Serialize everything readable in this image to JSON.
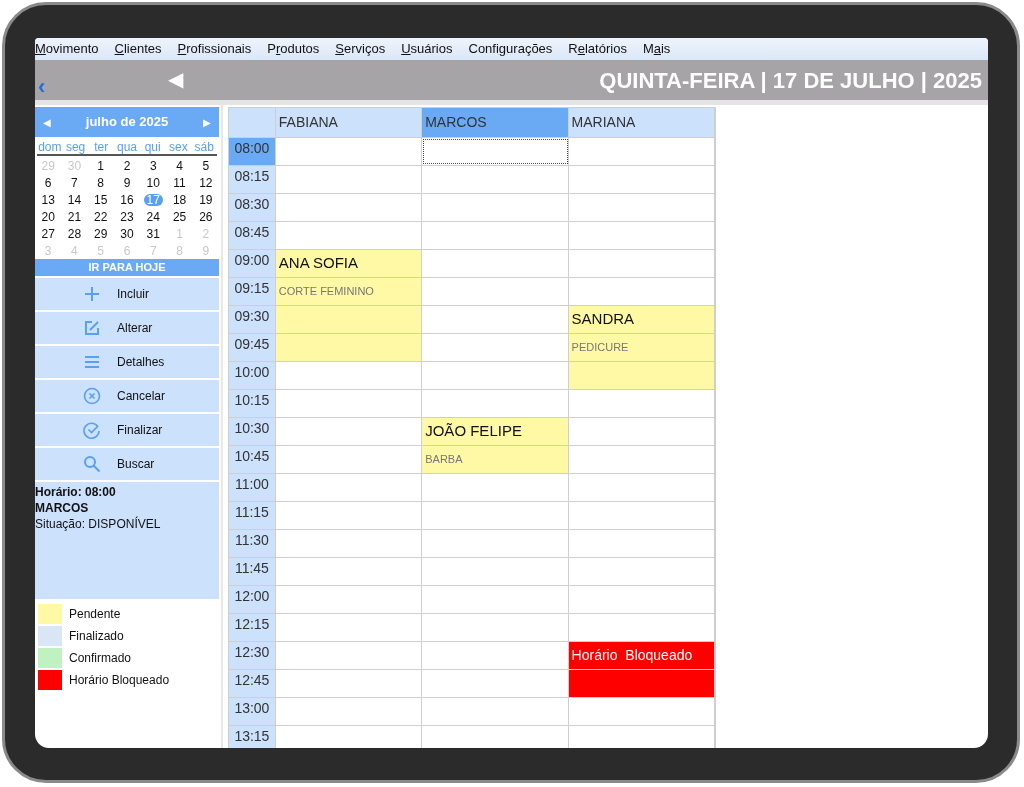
{
  "menu": [
    {
      "key": "M",
      "after": "ovimento"
    },
    {
      "key": "C",
      "after": "lientes"
    },
    {
      "key": "P",
      "after": "rofissionais"
    },
    {
      "before": "P",
      "key": "r",
      "after": "odutos"
    },
    {
      "key": "S",
      "after": "erviços"
    },
    {
      "key": "U",
      "after": "suários"
    },
    {
      "before": "Confi",
      "key": "g",
      "after": "urações"
    },
    {
      "before": "R",
      "key": "e",
      "after": "latórios"
    },
    {
      "before": "M",
      "key": "a",
      "after": "is"
    }
  ],
  "header": {
    "back": "‹",
    "previous": "◀",
    "title": "QUINTA-FEIRA | 17 DE JULHO | 2025"
  },
  "calendar": {
    "previous": "◀",
    "month": "julho de 2025",
    "next": "▶",
    "weekdays": [
      "dom",
      "seg",
      "ter",
      "qua",
      "qui",
      "sex",
      "sáb"
    ],
    "days": [
      {
        "label": "29",
        "muted": true,
        "selected": false
      },
      {
        "label": "30",
        "muted": true,
        "selected": false
      },
      {
        "label": "1",
        "muted": false,
        "selected": false
      },
      {
        "label": "2",
        "muted": false,
        "selected": false
      },
      {
        "label": "3",
        "muted": false,
        "selected": false
      },
      {
        "label": "4",
        "muted": false,
        "selected": false
      },
      {
        "label": "5",
        "muted": false,
        "selected": false
      },
      {
        "label": "6",
        "muted": false,
        "selected": false
      },
      {
        "label": "7",
        "muted": false,
        "selected": false
      },
      {
        "label": "8",
        "muted": false,
        "selected": false
      },
      {
        "label": "9",
        "muted": false,
        "selected": false
      },
      {
        "label": "10",
        "muted": false,
        "selected": false
      },
      {
        "label": "11",
        "muted": false,
        "selected": false
      },
      {
        "label": "12",
        "muted": false,
        "selected": false
      },
      {
        "label": "13",
        "muted": false,
        "selected": false
      },
      {
        "label": "14",
        "muted": false,
        "selected": false
      },
      {
        "label": "15",
        "muted": false,
        "selected": false
      },
      {
        "label": "16",
        "muted": false,
        "selected": false
      },
      {
        "label": "17",
        "muted": false,
        "selected": true
      },
      {
        "label": "18",
        "muted": false,
        "selected": false
      },
      {
        "label": "19",
        "muted": false,
        "selected": false
      },
      {
        "label": "20",
        "muted": false,
        "selected": false
      },
      {
        "label": "21",
        "muted": false,
        "selected": false
      },
      {
        "label": "22",
        "muted": false,
        "selected": false
      },
      {
        "label": "23",
        "muted": false,
        "selected": false
      },
      {
        "label": "24",
        "muted": false,
        "selected": false
      },
      {
        "label": "25",
        "muted": false,
        "selected": false
      },
      {
        "label": "26",
        "muted": false,
        "selected": false
      },
      {
        "label": "27",
        "muted": false,
        "selected": false
      },
      {
        "label": "28",
        "muted": false,
        "selected": false
      },
      {
        "label": "29",
        "muted": false,
        "selected": false
      },
      {
        "label": "30",
        "muted": false,
        "selected": false
      },
      {
        "label": "31",
        "muted": false,
        "selected": false
      },
      {
        "label": "1",
        "muted": true,
        "selected": false
      },
      {
        "label": "2",
        "muted": true,
        "selected": false
      },
      {
        "label": "3",
        "muted": true,
        "selected": false
      },
      {
        "label": "4",
        "muted": true,
        "selected": false
      },
      {
        "label": "5",
        "muted": true,
        "selected": false
      },
      {
        "label": "6",
        "muted": true,
        "selected": false
      },
      {
        "label": "7",
        "muted": true,
        "selected": false
      },
      {
        "label": "8",
        "muted": true,
        "selected": false
      },
      {
        "label": "9",
        "muted": true,
        "selected": false
      }
    ],
    "today_button": "IR PARA HOJE"
  },
  "actions": [
    {
      "kind": "plus",
      "label": "Incluir"
    },
    {
      "kind": "edit",
      "label": "Alterar"
    },
    {
      "kind": "list",
      "label": "Detalhes"
    },
    {
      "kind": "cancel",
      "label": "Cancelar"
    },
    {
      "kind": "check",
      "label": "Finalizar"
    },
    {
      "kind": "search",
      "label": "Buscar"
    }
  ],
  "info": [
    {
      "text": "Horário: 08:00",
      "bold": true
    },
    {
      "text": "MARCOS",
      "bold": true
    },
    {
      "text": "Situação: DISPONÍVEL",
      "bold": false
    }
  ],
  "legend": [
    {
      "label": "Pendente",
      "color": "#fff9a6"
    },
    {
      "label": "Finalizado",
      "color": "#dae6f6"
    },
    {
      "label": "Confirmado",
      "color": "#bff2c0"
    },
    {
      "label": "Horário Bloqueado",
      "color": "#ff0000"
    }
  ],
  "columns": [
    {
      "name": "FABIANA",
      "selected": false
    },
    {
      "name": "MARCOS",
      "selected": true
    },
    {
      "name": "MARIANA",
      "selected": false
    }
  ],
  "rows": [
    {
      "time": "08:00",
      "selected": true,
      "cells": [
        {},
        {},
        {}
      ]
    },
    {
      "time": "08:15",
      "selected": false,
      "cells": [
        {},
        {},
        {}
      ]
    },
    {
      "time": "08:30",
      "selected": false,
      "cells": [
        {},
        {},
        {}
      ]
    },
    {
      "time": "08:45",
      "selected": false,
      "cells": [
        {},
        {},
        {}
      ]
    },
    {
      "time": "09:00",
      "selected": false,
      "cells": [
        {
          "kind": "name",
          "text": "ANA SOFIA",
          "color": "#fff9a6"
        },
        {},
        {}
      ]
    },
    {
      "time": "09:15",
      "selected": false,
      "cells": [
        {
          "kind": "service",
          "text": "CORTE FEMININO",
          "color": "#fff9a6"
        },
        {},
        {}
      ]
    },
    {
      "time": "09:30",
      "selected": false,
      "cells": [
        {
          "color": "#fff9a6"
        },
        {},
        {
          "kind": "name",
          "text": "SANDRA",
          "color": "#fff9a6"
        }
      ]
    },
    {
      "time": "09:45",
      "selected": false,
      "cells": [
        {
          "color": "#fff9a6"
        },
        {},
        {
          "kind": "service",
          "text": "PEDICURE",
          "color": "#fff9a6"
        }
      ]
    },
    {
      "time": "10:00",
      "selected": false,
      "cells": [
        {},
        {},
        {
          "color": "#fff9a6"
        }
      ]
    },
    {
      "time": "10:15",
      "selected": false,
      "cells": [
        {},
        {},
        {}
      ]
    },
    {
      "time": "10:30",
      "selected": false,
      "cells": [
        {},
        {
          "kind": "name",
          "text": "JOÃO FELIPE",
          "color": "#fff9a6"
        },
        {}
      ]
    },
    {
      "time": "10:45",
      "selected": false,
      "cells": [
        {},
        {
          "kind": "service",
          "text": "BARBA",
          "color": "#fff9a6"
        },
        {}
      ]
    },
    {
      "time": "11:00",
      "selected": false,
      "cells": [
        {},
        {},
        {}
      ]
    },
    {
      "time": "11:15",
      "selected": false,
      "cells": [
        {},
        {},
        {}
      ]
    },
    {
      "time": "11:30",
      "selected": false,
      "cells": [
        {},
        {},
        {}
      ]
    },
    {
      "time": "11:45",
      "selected": false,
      "cells": [
        {},
        {},
        {}
      ]
    },
    {
      "time": "12:00",
      "selected": false,
      "cells": [
        {},
        {},
        {}
      ]
    },
    {
      "time": "12:15",
      "selected": false,
      "cells": [
        {},
        {},
        {}
      ]
    },
    {
      "time": "12:30",
      "selected": false,
      "cells": [
        {},
        {},
        {
          "kind": "blocked",
          "text": "Horário  Bloqueado",
          "color": "#ff0000"
        }
      ]
    },
    {
      "time": "12:45",
      "selected": false,
      "cells": [
        {},
        {},
        {
          "color": "#ff0000"
        }
      ]
    },
    {
      "time": "13:00",
      "selected": false,
      "cells": [
        {},
        {},
        {}
      ]
    },
    {
      "time": "13:15",
      "selected": false,
      "cells": [
        {},
        {},
        {}
      ]
    }
  ]
}
